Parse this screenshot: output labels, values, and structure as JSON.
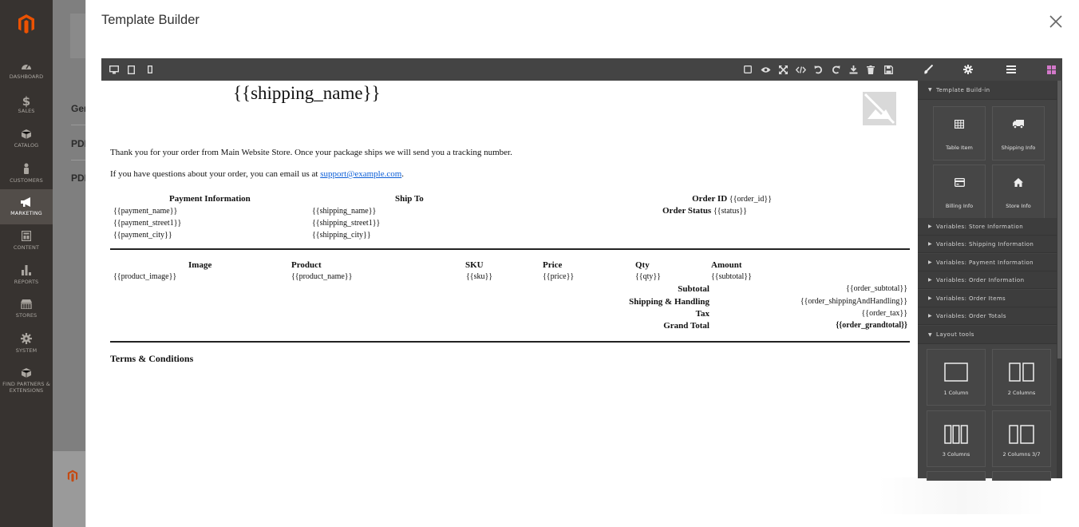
{
  "modal": {
    "title": "Template Builder"
  },
  "sidebar": {
    "items": [
      {
        "label": "DASHBOARD",
        "icon": "dashboard-icon"
      },
      {
        "label": "SALES",
        "icon": "dollar-icon"
      },
      {
        "label": "CATALOG",
        "icon": "box-icon"
      },
      {
        "label": "CUSTOMERS",
        "icon": "person-icon"
      },
      {
        "label": "MARKETING",
        "icon": "megaphone-icon"
      },
      {
        "label": "CONTENT",
        "icon": "layout-icon"
      },
      {
        "label": "REPORTS",
        "icon": "bar-chart-icon"
      },
      {
        "label": "STORES",
        "icon": "store-icon"
      },
      {
        "label": "SYSTEM",
        "icon": "gear-icon"
      },
      {
        "label": "FIND PARTNERS & EXTENSIONS",
        "icon": "box-icon"
      }
    ],
    "active": "MARKETING"
  },
  "background": {
    "tab_general": "Ger",
    "tab_pdf1": "PDF",
    "tab_pdf2": "PDF"
  },
  "document": {
    "shipping_name_heading": "{{shipping_name}}",
    "thanks": "Thank you for your order from Main Website Store. Once your package ships we will send you a tracking number.",
    "questions_prefix": "If you have questions about your order, you can email us at ",
    "support_email": "support@example.com",
    "questions_suffix": ".",
    "payment_header": "Payment Information",
    "payment_lines": [
      "{{payment_name}}",
      "{{payment_street1}}",
      "{{payment_city}}"
    ],
    "ship_header": "Ship To",
    "ship_lines": [
      "{{shipping_name}}",
      "{{shipping_street1}}",
      "{{shipping_city}}"
    ],
    "order_id_label": "Order ID",
    "order_id_value": "{{order_id}}",
    "order_status_label": "Order Status",
    "order_status_value": "{{status}}",
    "items_headers": [
      "Image",
      "Product",
      "SKU",
      "Price",
      "Qty",
      "Amount"
    ],
    "items_row": [
      "{{product_image}}",
      "{{product_name}}",
      "{{sku}}",
      "{{price}}",
      "{{qty}}",
      "{{subtotal}}"
    ],
    "totals": [
      {
        "label": "Subtotal",
        "value": "{{order_subtotal}}"
      },
      {
        "label": "Shipping & Handling",
        "value": "{{order_shippingAndHandling}}"
      },
      {
        "label": "Tax",
        "value": "{{order_tax}}"
      },
      {
        "label": "Grand Total",
        "value": "{{order_grandtotal}}"
      }
    ],
    "terms": "Terms & Conditions"
  },
  "panel": {
    "section_template": "Template Build-in",
    "blocks_template": [
      {
        "label": "Table Item",
        "icon": "table-icon"
      },
      {
        "label": "Shipping Info",
        "icon": "truck-icon"
      },
      {
        "label": "Billing Info",
        "icon": "credit-card-icon"
      },
      {
        "label": "Store Info",
        "icon": "home-icon"
      }
    ],
    "variable_sections": [
      "Variables: Store Information",
      "Variables: Shipping Information",
      "Variables: Payment Information",
      "Variables: Order Information",
      "Variables: Order Items",
      "Variables: Order Totals"
    ],
    "section_layout": "Layout tools",
    "blocks_layout": [
      {
        "label": "1 Column",
        "icon": "one-column-icon"
      },
      {
        "label": "2 Columns",
        "icon": "two-columns-icon"
      },
      {
        "label": "3 Columns",
        "icon": "three-columns-icon"
      },
      {
        "label": "2 Columns 3/7",
        "icon": "two-columns-37-icon"
      }
    ]
  },
  "colors": {
    "sidebar": "#373330",
    "toolbar": "#444444",
    "accent": "#eb5202",
    "active_panel_icon": "#d278c9",
    "link": "#0b5ed7"
  }
}
